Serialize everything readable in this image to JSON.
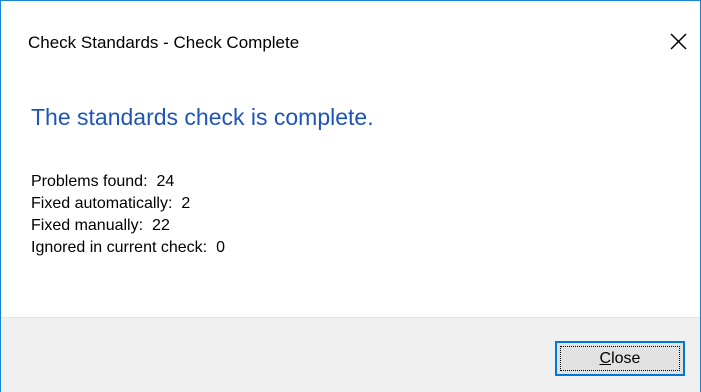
{
  "window": {
    "title": "Check Standards - Check Complete",
    "close_icon": "close-icon"
  },
  "heading": "The standards check is complete.",
  "colors": {
    "heading": "#1f55b8",
    "border": "#1883d7",
    "footer": "#f0f0f0",
    "button_border": "#0078d7"
  },
  "stats": [
    {
      "label": "Problems found:",
      "value": "24"
    },
    {
      "label": "Fixed automatically:",
      "value": "2"
    },
    {
      "label": "Fixed manually:",
      "value": "22"
    },
    {
      "label": "Ignored in current check:",
      "value": "0"
    }
  ],
  "footer": {
    "close_button": {
      "mnemonic": "C",
      "rest": "lose"
    }
  }
}
